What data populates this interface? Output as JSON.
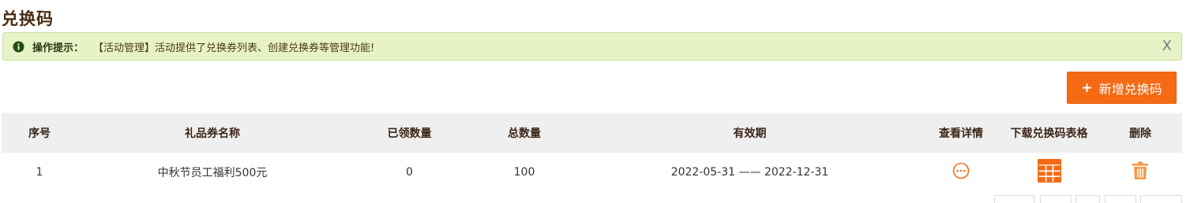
{
  "page": {
    "title": "兑换码"
  },
  "tip": {
    "label": "操作提示：",
    "text": "【活动管理】活动提供了兑换券列表、创建兑换券等管理功能!",
    "close": "X"
  },
  "actions": {
    "add_label": "新增兑换码",
    "add_plus": "+"
  },
  "table": {
    "headers": [
      "序号",
      "礼品券名称",
      "已领数量",
      "总数量",
      "有效期",
      "查看详情",
      "下载兑换码表格",
      "删除"
    ],
    "rows": [
      {
        "index": "1",
        "name": "中秋节员工福利500元",
        "claimed": "0",
        "total": "100",
        "validity": "2022-05-31 —— 2022-12-31"
      }
    ]
  },
  "colors": {
    "accent": "#f56a14",
    "title": "#4a2c12",
    "tip_bg": "#e7f3c6"
  },
  "icons": [
    "info-icon",
    "close-icon",
    "plus-icon",
    "more-details-icon",
    "table-grid-icon",
    "trash-icon"
  ]
}
